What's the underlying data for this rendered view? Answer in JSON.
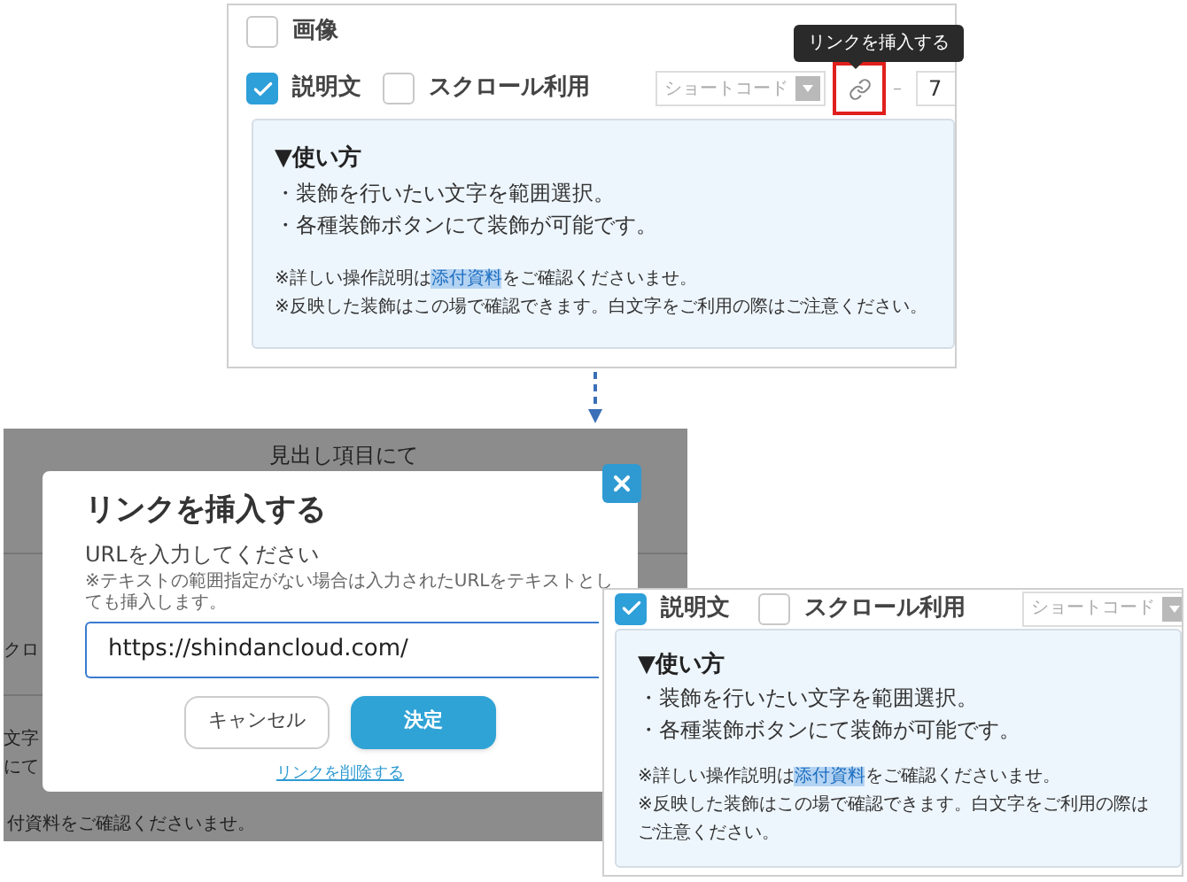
{
  "editor_before": {
    "image_option": {
      "label": "画像",
      "checked": false
    },
    "options": [
      {
        "label": "説明文",
        "checked": true
      },
      {
        "label": "スクロール利用",
        "checked": false
      }
    ],
    "shortcode_select": {
      "placeholder": "ショートコード"
    },
    "link_tooltip": "リンクを挿入する",
    "separator": "–",
    "size_field": {
      "value": "7"
    },
    "description": {
      "heading": "▼使い方",
      "lines": [
        "・装飾を行いたい文字を範囲選択。",
        "・各種装飾ボタンにて装飾が可能です。"
      ],
      "notes": [
        {
          "before": "※詳しい操作説明は",
          "highlight": "添付資料",
          "after": "をご確認くださいませ。"
        },
        {
          "before": "※反映した装飾はこの場で確認できます。白文字をご利用の際はご注意ください。"
        }
      ]
    }
  },
  "dimmed_page": {
    "heading": "見出し項目にて",
    "fragments": [
      "クロ",
      "文字",
      "にて"
    ],
    "footer": "付資料をご確認くださいませ。"
  },
  "link_dialog": {
    "title": "リンクを挿入する",
    "prompt": "URLを入力してください",
    "note": "※テキストの範囲指定がない場合は入力されたURLをテキストとしても挿入します。",
    "url": {
      "value": "https://shindancloud.com/"
    },
    "buttons": [
      {
        "label": "キャンセル",
        "kind": "secondary"
      },
      {
        "label": "決定",
        "kind": "primary"
      }
    ],
    "remove_link": "リンクを削除する"
  },
  "editor_after": {
    "options": [
      {
        "label": "説明文",
        "checked": true
      },
      {
        "label": "スクロール利用",
        "checked": false
      }
    ],
    "shortcode_select": {
      "placeholder": "ショートコード"
    },
    "description": {
      "heading": "▼使い方",
      "lines": [
        "・装飾を行いたい文字を範囲選択。",
        "・各種装飾ボタンにて装飾が可能です。"
      ],
      "notes": [
        {
          "before": "※詳しい操作説明は",
          "highlight": "添付資料",
          "after": "をご確認くださいませ。"
        },
        {
          "before": "※反映した装飾はこの場で確認できます。白文字をご利用の際はご注意ください。"
        }
      ]
    }
  }
}
